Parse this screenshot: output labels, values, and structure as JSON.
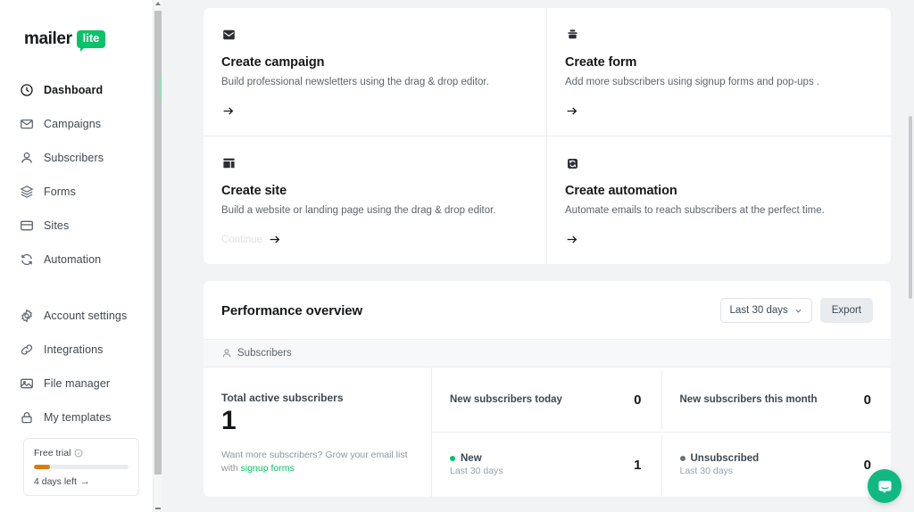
{
  "brand": {
    "name": "mailer",
    "badge": "lite",
    "accent": "#09c269"
  },
  "sidebar": {
    "primary_items": [
      {
        "label": "Dashboard",
        "icon": "clock-icon",
        "active": true
      },
      {
        "label": "Campaigns",
        "icon": "envelope-icon",
        "active": false
      },
      {
        "label": "Subscribers",
        "icon": "user-icon",
        "active": false
      },
      {
        "label": "Forms",
        "icon": "layers-icon",
        "active": false
      },
      {
        "label": "Sites",
        "icon": "window-icon",
        "active": false
      },
      {
        "label": "Automation",
        "icon": "refresh-icon",
        "active": false
      }
    ],
    "secondary_items": [
      {
        "label": "Account settings",
        "icon": "gear-icon"
      },
      {
        "label": "Integrations",
        "icon": "link-icon"
      },
      {
        "label": "File manager",
        "icon": "image-icon"
      },
      {
        "label": "My templates",
        "icon": "lock-icon"
      }
    ],
    "trial": {
      "label": "Free trial",
      "info_icon": "info-icon",
      "days_left": "4 days left",
      "arrow": "→",
      "progress_percent": 17,
      "bar_color": "#d97d0d"
    }
  },
  "promo_cards": [
    {
      "icon": "envelope-icon",
      "title": "Create campaign",
      "description": "Build professional newsletters using the drag & drop editor.",
      "action_label": "",
      "arrow": "arrow-right-icon"
    },
    {
      "icon": "form-icon",
      "title": "Create form",
      "description": "Add more subscribers using signup forms and pop-ups .",
      "action_label": "",
      "arrow": "arrow-right-icon"
    },
    {
      "icon": "layout-icon",
      "title": "Create site",
      "description": "Build a website or landing page using the drag & drop editor.",
      "action_label": "Continue",
      "arrow": "arrow-right-icon"
    },
    {
      "icon": "automation-icon",
      "title": "Create automation",
      "description": "Automate emails to reach subscribers at the perfect time.",
      "action_label": "",
      "arrow": "arrow-right-icon"
    }
  ],
  "performance": {
    "title": "Performance overview",
    "date_range": "Last 30 days",
    "export_label": "Export",
    "section_label": "Subscribers",
    "section_icon": "user-icon",
    "total": {
      "label": "Total active subscribers",
      "value": "1",
      "hint_prefix": "Want more subscribers? Grow your email list with",
      "hint_link": "signup forms"
    },
    "stats": [
      {
        "label": "New subscribers today",
        "value": "0",
        "sub": "",
        "dot": ""
      },
      {
        "label": "New subscribers this month",
        "value": "0",
        "sub": "",
        "dot": ""
      },
      {
        "label": "New",
        "value": "1",
        "sub": "Last 30 days",
        "dot": "green"
      },
      {
        "label": "Unsubscribed",
        "value": "0",
        "sub": "Last 30 days",
        "dot": "gray"
      }
    ]
  },
  "chat_widget": {
    "icon": "chat-bubble-icon",
    "color": "#10b981"
  }
}
